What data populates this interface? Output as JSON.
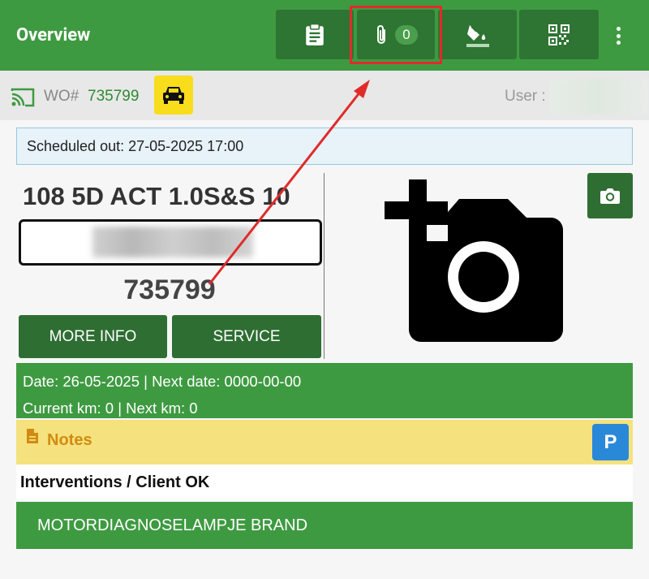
{
  "appbar": {
    "title": "Overview",
    "attachments_count": "0",
    "buttons": [
      {
        "icon": "clipboard-icon"
      },
      {
        "icon": "paperclip-icon"
      },
      {
        "icon": "paint-bucket-icon"
      },
      {
        "icon": "qr-code-icon"
      }
    ]
  },
  "infobar": {
    "wo_label": "WO#",
    "wo_number": "735799",
    "user_label": "User :"
  },
  "schedule": {
    "text": "Scheduled out: 27-05-2025 17:00"
  },
  "vehicle": {
    "title": "108 5D ACT 1.0S&S 10",
    "wo_number": "735799",
    "more_info_label": "MORE INFO",
    "service_label": "SERVICE"
  },
  "dates": {
    "line1": "Date: 26-05-2025 | Next date: 0000-00-00",
    "line2": "Current km: 0 | Next km: 0"
  },
  "notes": {
    "label": "Notes",
    "badge": "P"
  },
  "interventions": {
    "heading": "Interventions / Client OK",
    "item": "MOTORDIAGNOSELAMPJE BRAND"
  },
  "colors": {
    "primary": "#3e9a41",
    "primary_dark": "#2e6e32",
    "accent_yellow": "#f9dc1c",
    "notes_bg": "#f5e27e",
    "badge_blue": "#2a88d8",
    "highlight_red": "#e02b2b"
  }
}
